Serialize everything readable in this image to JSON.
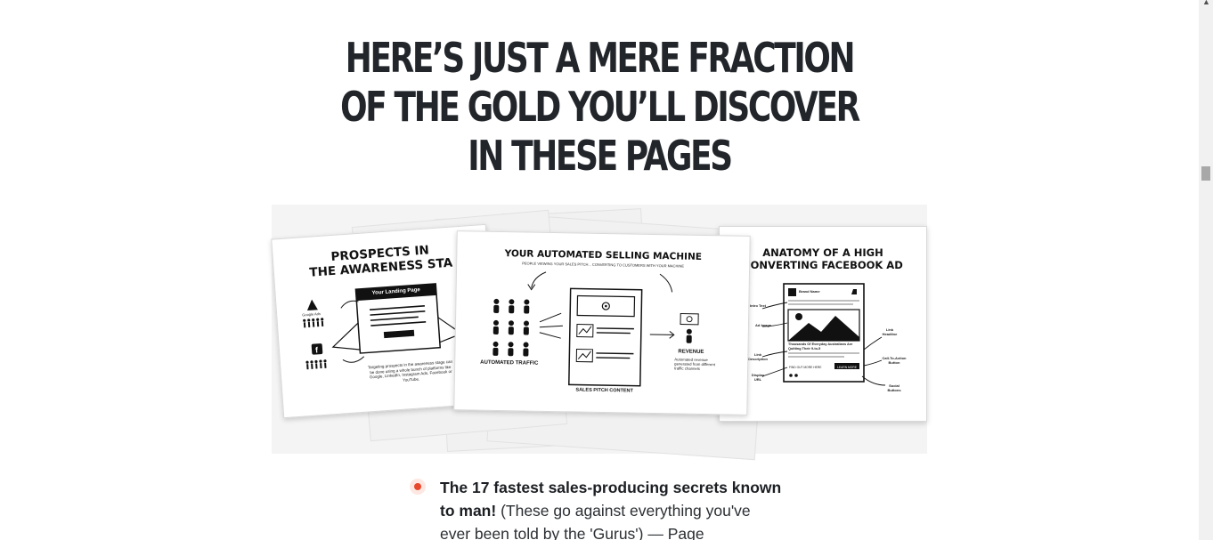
{
  "headline": {
    "lines": [
      "HERE’S JUST A MERE FRACTION",
      "OF THE GOLD YOU’LL DISCOVER",
      "IN THESE PAGES"
    ]
  },
  "card_left": {
    "title_line1": "PROSPECTS IN",
    "title_line2": "THE AWARENESS STA",
    "landing_label": "Your Landing Page",
    "google_label": "Google Ads",
    "caption": "Targeting prospects in the awareness stage can be done using a whole bunch of platforms like Google, LinkedIn, Instagram Ads, Facebook or YouTube."
  },
  "card_middle": {
    "title": "YOUR AUTOMATED SELLING MACHINE",
    "subtitle": "PEOPLE VIEWING YOUR SALES PITCH... CONVERTING TO CUSTOMERS WITH YOUR MACHINE",
    "traffic_label": "AUTOMATED TRAFFIC",
    "content_label": "SALES PITCH CONTENT",
    "revenue_label": "REVENUE",
    "revenue_caption": "Automated revenue generated from different traffic channels"
  },
  "card_right": {
    "title_line1": "ANATOMY OF A HIGH",
    "title_line2": "CONVERTING FACEBOOK AD",
    "brand_label": "Brand Name",
    "ad_headline": "Thousands Of Everyday Australians Are Quitting Their 9-to-5",
    "cta_text": "FIND OUT MORE HERE",
    "cta_button": "LEARN MORE",
    "labels": {
      "intro": "Intro Text",
      "image": "Ad Image",
      "link_desc": "Link Description",
      "display_url": "Display URL",
      "link_headline": "Link Headline",
      "cta": "Call-To-Action Button",
      "social": "Social Buttons"
    }
  },
  "bullet": {
    "bold": "The 17 fastest sales-producing secrets known to man!",
    "text": " (These go against everything you've ever been told by the 'Gurus') — Page"
  },
  "colors": {
    "bullet_accent": "#e8492d",
    "bullet_halo": "#fde7e2",
    "headline": "#22262b"
  }
}
